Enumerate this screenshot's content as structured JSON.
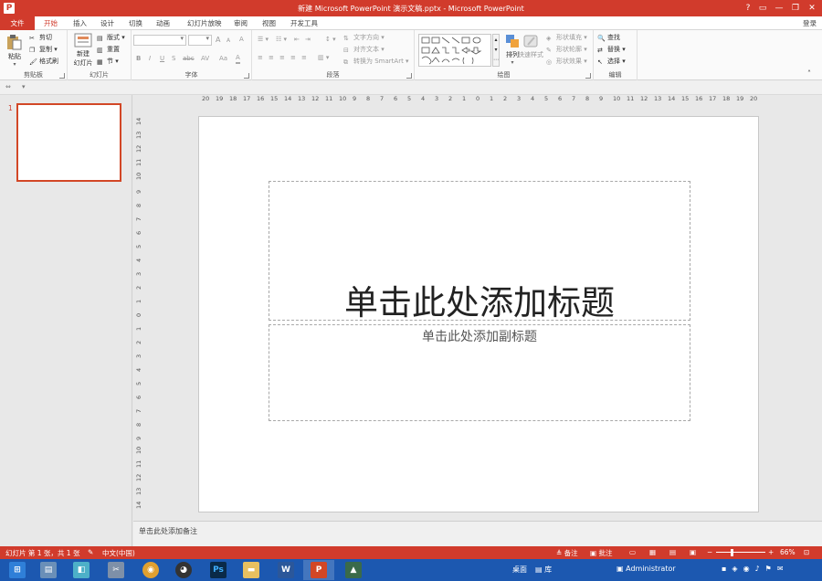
{
  "window": {
    "title": "新建 Microsoft PowerPoint 演示文稿.pptx - Microsoft PowerPoint",
    "help": "?",
    "minimize": "—",
    "maximize": "❐",
    "close": "✕"
  },
  "tabs": {
    "file": "文件",
    "home": "开始",
    "insert": "插入",
    "design": "设计",
    "transitions": "切换",
    "animations": "动画",
    "slideshow": "幻灯片放映",
    "review": "审阅",
    "view": "视图",
    "developer": "开发工具",
    "login": "登录"
  },
  "ribbon": {
    "clipboard": {
      "label": "剪贴板",
      "paste": "粘贴",
      "cut": "剪切",
      "copy": "复制",
      "format_painter": "格式刷"
    },
    "slides": {
      "label": "幻灯片",
      "new_slide_1": "新建",
      "new_slide_2": "幻灯片",
      "layout": "版式",
      "reset": "重置",
      "section": "节"
    },
    "font": {
      "label": "字体",
      "bold": "B",
      "italic": "I",
      "underline": "U",
      "strike": "S",
      "shadow": "abc",
      "spacing": "AV",
      "case": "Aa",
      "grow": "A",
      "shrink": "A",
      "clear": "A",
      "color": "A"
    },
    "paragraph": {
      "label": "段落",
      "text_direction": "文字方向",
      "align_text": "对齐文本",
      "smartart": "转换为 SmartArt"
    },
    "drawing": {
      "label": "绘图",
      "arrange": "排列",
      "quick_styles": "快速样式",
      "shape_fill": "形状填充",
      "shape_outline": "形状轮廓",
      "shape_effects": "形状效果"
    },
    "editing": {
      "label": "编辑",
      "find": "查找",
      "replace": "替换",
      "select": "选择"
    }
  },
  "ruler": {
    "horizontal": [
      "20",
      "19",
      "18",
      "17",
      "16",
      "15",
      "14",
      "13",
      "12",
      "11",
      "10",
      "9",
      "8",
      "7",
      "6",
      "5",
      "4",
      "3",
      "2",
      "1",
      "0",
      "1",
      "2",
      "3",
      "4",
      "5",
      "6",
      "7",
      "8",
      "9",
      "10",
      "11",
      "12",
      "13",
      "14",
      "15",
      "16",
      "17",
      "18",
      "19",
      "20"
    ],
    "vertical": [
      "14",
      "13",
      "12",
      "11",
      "10",
      "9",
      "8",
      "7",
      "6",
      "5",
      "4",
      "3",
      "2",
      "1",
      "0",
      "1",
      "2",
      "3",
      "4",
      "5",
      "6",
      "7",
      "8",
      "9",
      "10",
      "11",
      "12",
      "13",
      "14"
    ]
  },
  "thumbnails": {
    "slide1_number": "1"
  },
  "slide": {
    "title_placeholder": "单击此处添加标题",
    "subtitle_placeholder": "单击此处添加副标题"
  },
  "notes": {
    "placeholder": "单击此处添加备注"
  },
  "status": {
    "slide_info": "幻灯片 第 1 张，共 1 张",
    "language": "中文(中国)",
    "notes": "备注",
    "comments": "批注",
    "zoom_minus": "−",
    "zoom_plus": "+",
    "zoom": "66%",
    "zoom_level": 0.66
  },
  "taskbar": {
    "desktop": "桌面",
    "library": "库",
    "user": "Administrator"
  },
  "colors": {
    "accent": "#d13b2c",
    "slide_selection": "#d24726",
    "taskbar": "#1c58b0"
  }
}
